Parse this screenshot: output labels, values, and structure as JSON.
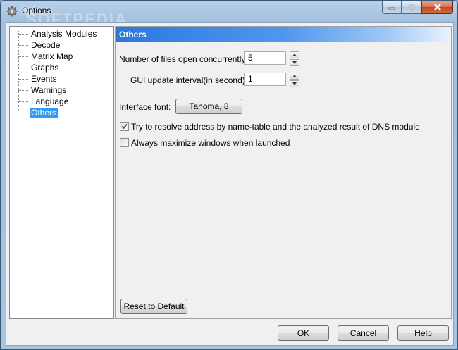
{
  "window": {
    "title": "Options",
    "watermark": "SOFTPEDIA"
  },
  "tree": {
    "items": [
      {
        "label": "Analysis Modules",
        "selected": false
      },
      {
        "label": "Decode",
        "selected": false
      },
      {
        "label": "Matrix Map",
        "selected": false
      },
      {
        "label": "Graphs",
        "selected": false
      },
      {
        "label": "Events",
        "selected": false
      },
      {
        "label": "Warnings",
        "selected": false
      },
      {
        "label": "Language",
        "selected": false
      },
      {
        "label": "Others",
        "selected": true
      }
    ]
  },
  "panel": {
    "title": "Others",
    "files_label": "Number of files open concurrently:",
    "files_value": "5",
    "gui_label": "GUI update interval(in second):",
    "gui_value": "1",
    "font_label": "Interface font:",
    "font_button": "Tahoma, 8",
    "resolve_label": "Try to resolve address by name-table and the analyzed result of DNS module",
    "resolve_checked": true,
    "maximize_label": "Always maximize windows when launched",
    "maximize_checked": false,
    "reset_button": "Reset to Default"
  },
  "footer": {
    "ok": "OK",
    "cancel": "Cancel",
    "help": "Help"
  },
  "colors": {
    "header": "#2a78e0",
    "selection": "#3399ff"
  }
}
